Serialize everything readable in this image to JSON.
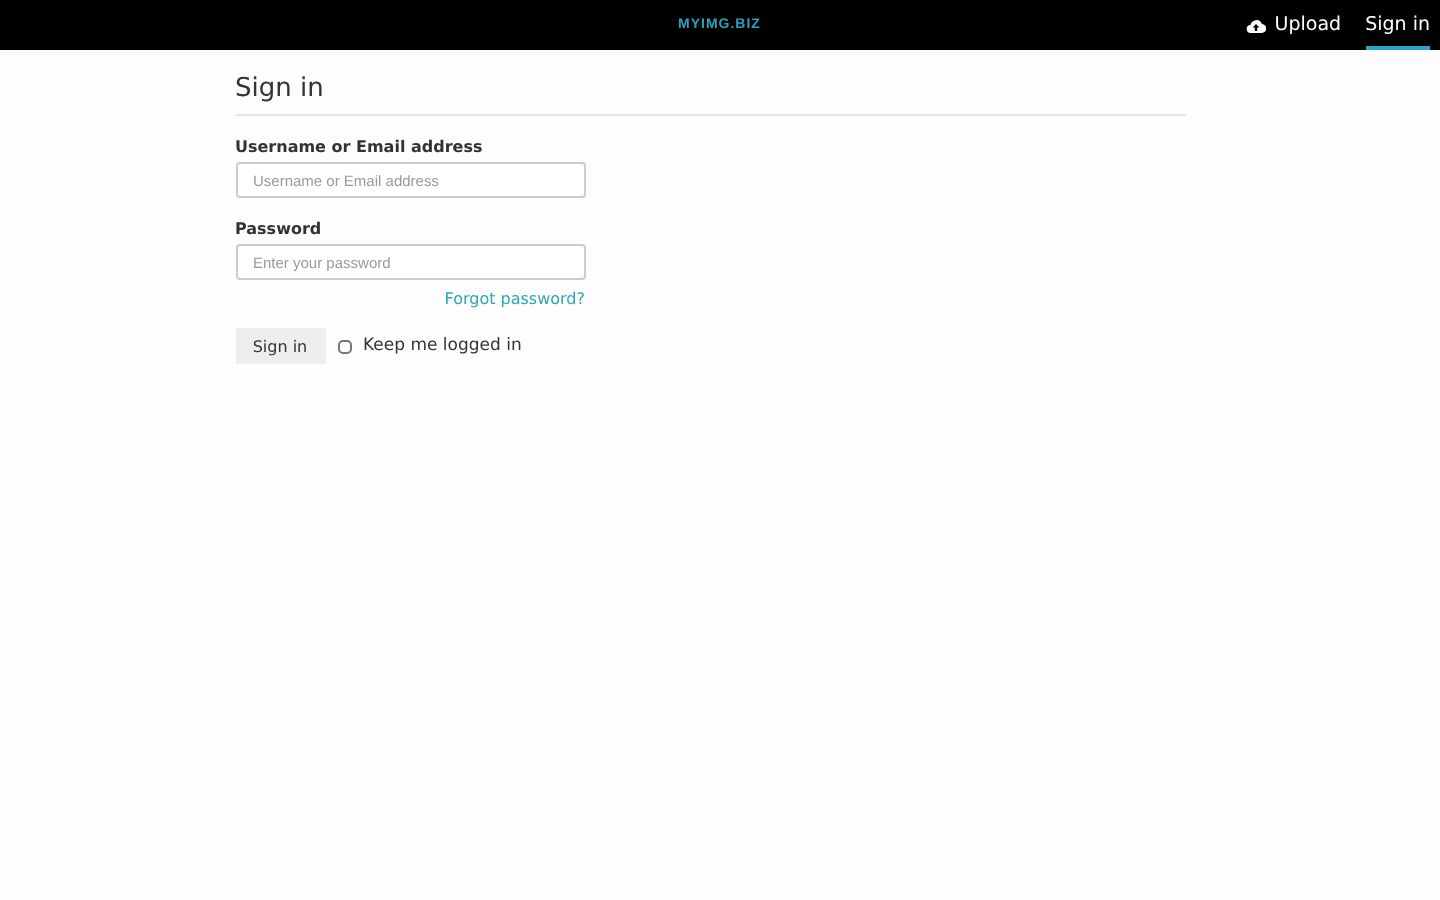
{
  "header": {
    "logo": "MYIMG.BIZ",
    "nav": [
      {
        "label": "Upload",
        "kind": "upload",
        "selected": false
      },
      {
        "label": "Sign in",
        "kind": "link",
        "selected": true
      }
    ]
  },
  "form": {
    "title": "Sign in",
    "fields": [
      {
        "label": "Username or Email address",
        "placeholder": "Username or Email address"
      },
      {
        "label": "Password",
        "placeholder": "Enter your password"
      }
    ],
    "forgot_link": "Forgot password?",
    "submit": "Sign in",
    "remember": {
      "label": "Keep me logged in",
      "checked": false
    }
  }
}
